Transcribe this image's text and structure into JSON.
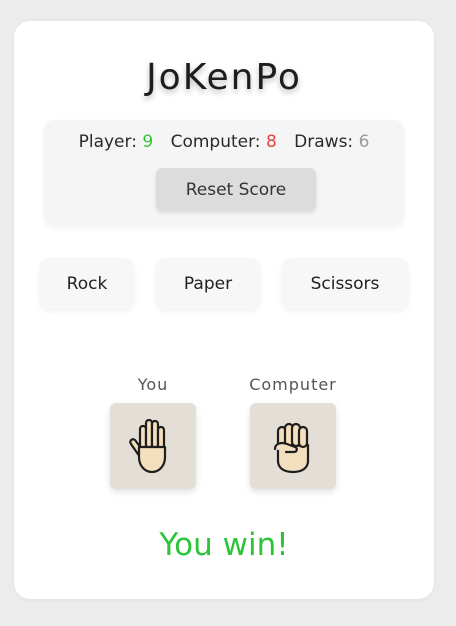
{
  "app": {
    "title": "JoKenPo"
  },
  "score": {
    "player_label": "Player:",
    "player_value": "9",
    "computer_label": "Computer:",
    "computer_value": "8",
    "draws_label": "Draws:",
    "draws_value": "6",
    "reset_label": "Reset Score"
  },
  "choices": [
    {
      "label": "Rock"
    },
    {
      "label": "Paper"
    },
    {
      "label": "Scissors"
    }
  ],
  "hands": {
    "you_label": "You",
    "you_choice_icon": "open-hand-icon",
    "computer_label": "Computer",
    "computer_choice_icon": "fist-icon"
  },
  "result": {
    "text": "You win!",
    "color": "#2ec437"
  },
  "colors": {
    "player": "#36c236",
    "computer": "#e3453d",
    "draws": "#9a9a9a",
    "hand_box_bg": "#e3dfd6",
    "page_bg": "#ececec"
  }
}
